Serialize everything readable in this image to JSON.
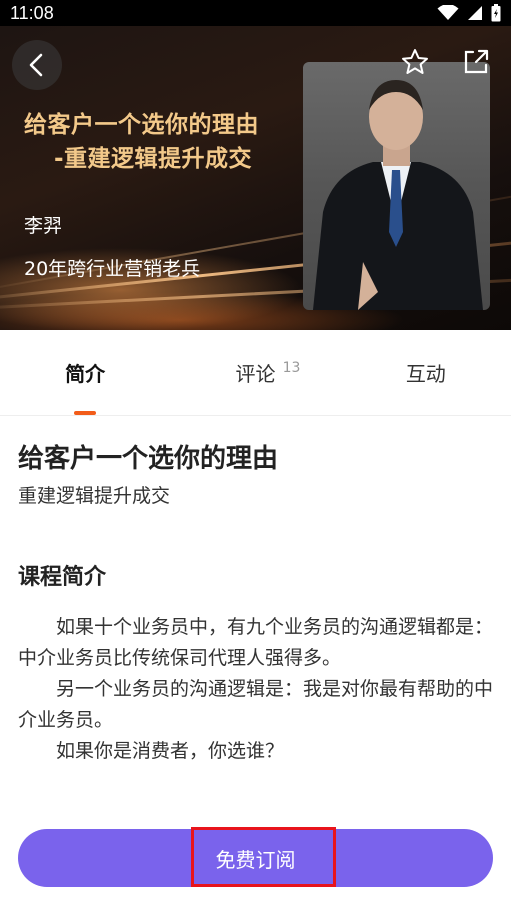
{
  "status_bar": {
    "time": "11:08"
  },
  "hero": {
    "title_line1": "给客户一个选你的理由",
    "title_line2": "-重建逻辑提升成交",
    "lecturer_name": "李羿",
    "lecturer_desc": "20年跨行业营销老兵"
  },
  "icons": {
    "back": "chevron-left-icon",
    "star": "star-icon",
    "share": "share-icon"
  },
  "tabs": [
    {
      "label": "简介",
      "active": true
    },
    {
      "label": "评论",
      "badge": "13"
    },
    {
      "label": "互动"
    }
  ],
  "course": {
    "title": "给客户一个选你的理由",
    "subtitle": "重建逻辑提升成交",
    "section_heading": "课程简介",
    "intro": [
      "如果十个业务员中，有九个业务员的沟通逻辑都是：中介业务员比传统保司代理人强得多。",
      "另一个业务员的沟通逻辑是：我是对你最有帮助的中介业务员。",
      "如果你是消费者，你选谁？"
    ]
  },
  "subscribe": {
    "label": "免费订阅"
  },
  "colors": {
    "accent": "#f25c19",
    "button": "#7a63ec",
    "highlight": "#e8141c",
    "hero_title": "#f3c98a"
  }
}
